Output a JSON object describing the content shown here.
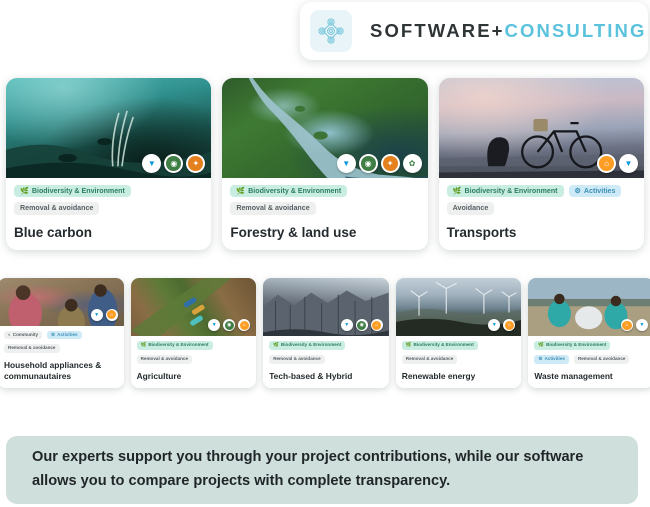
{
  "header": {
    "icon": "network-nodes-icon",
    "title_main": "SOFTWARE",
    "title_plus": "+",
    "title_accent": "CONSULTING"
  },
  "tag_labels": {
    "biodiversity": "Biodiversity & Environment",
    "removal_avoidance": "Removal & avoidance",
    "activities": "Activities",
    "avoidance": "Avoidance",
    "community": "Community"
  },
  "colors": {
    "tag_green_bg": "#c9ede0",
    "tag_green_fg": "#2d7d63",
    "tag_blue_bg": "#cfeaf7",
    "tag_blue_fg": "#3d8fb5",
    "tag_grey_bg": "#eef0f0",
    "tag_grey_fg": "#585f63",
    "accent_blue": "#5bc2dd",
    "banner_bg": "#cfdfdb",
    "title_dark": "#2f3437"
  },
  "big_cards": [
    {
      "title": "Blue carbon",
      "photo": "underwater-seagrass-photo",
      "tags": [
        {
          "label": "Biodiversity & Environment",
          "style": "green",
          "icon": "leaf-icon"
        },
        {
          "label": "Removal & avoidance",
          "style": "grey",
          "icon": ""
        }
      ],
      "sdg": [
        "sdg-14-life-below-water",
        "sdg-13-climate-action",
        "sdg-15-life-on-land"
      ]
    },
    {
      "title": "Forestry & land use",
      "photo": "aerial-forest-river-photo",
      "tags": [
        {
          "label": "Biodiversity & Environment",
          "style": "green",
          "icon": "leaf-icon"
        },
        {
          "label": "Removal & avoidance",
          "style": "grey",
          "icon": ""
        }
      ],
      "sdg": [
        "sdg-14-life-below-water",
        "sdg-13-climate-action",
        "sdg-15-life-on-land",
        "sdg-17-partnerships"
      ]
    },
    {
      "title": "Transports",
      "photo": "bicycle-city-dusk-photo",
      "tags": [
        {
          "label": "Biodiversity & Environment",
          "style": "green",
          "icon": "leaf-icon"
        },
        {
          "label": "Activities",
          "style": "blue",
          "icon": "gear-icon"
        },
        {
          "label": "Avoidance",
          "style": "grey",
          "icon": ""
        }
      ],
      "sdg": [
        "sdg-11-sustainable-cities",
        "sdg-14-life-below-water"
      ]
    }
  ],
  "small_cards": [
    {
      "title": "Household appliances & communautaires",
      "photo": "village-community-photo",
      "tags": [
        {
          "label": "Community",
          "style": "grey",
          "icon": "people-icon"
        },
        {
          "label": "Activities",
          "style": "blue",
          "icon": "gear-icon"
        },
        {
          "label": "Removal & avoidance",
          "style": "grey",
          "icon": ""
        }
      ],
      "sdg": [
        "sdg-14-life-below-water",
        "sdg-11-sustainable-cities"
      ]
    },
    {
      "title": "Agriculture",
      "photo": "aerial-farm-field-photo",
      "tags": [
        {
          "label": "Biodiversity & Environment",
          "style": "green",
          "icon": "leaf-icon"
        },
        {
          "label": "Removal & avoidance",
          "style": "grey",
          "icon": ""
        }
      ],
      "sdg": [
        "sdg-14-life-below-water",
        "sdg-06-clean-water",
        "sdg-11-sustainable-cities"
      ]
    },
    {
      "title": "Tech-based & Hybrid",
      "photo": "rock-cliff-photo",
      "tags": [
        {
          "label": "Biodiversity & Environment",
          "style": "green",
          "icon": "leaf-icon"
        },
        {
          "label": "Removal & avoidance",
          "style": "grey",
          "icon": ""
        }
      ],
      "sdg": [
        "sdg-14-life-below-water",
        "sdg-09-industry",
        "sdg-11-sustainable-cities"
      ]
    },
    {
      "title": "Renewable energy",
      "photo": "wind-turbines-photo",
      "tags": [
        {
          "label": "Biodiversity & Environment",
          "style": "green",
          "icon": "leaf-icon"
        },
        {
          "label": "Removal & avoidance",
          "style": "grey",
          "icon": ""
        }
      ],
      "sdg": [
        "sdg-14-life-below-water",
        "sdg-11-sustainable-cities"
      ]
    },
    {
      "title": "Waste management",
      "photo": "beach-cleanup-photo",
      "tags": [
        {
          "label": "Biodiversity & Environment",
          "style": "green",
          "icon": "leaf-icon"
        },
        {
          "label": "Activities",
          "style": "blue",
          "icon": "gear-icon"
        },
        {
          "label": "Removal & avoidance",
          "style": "grey",
          "icon": ""
        }
      ],
      "sdg": [
        "sdg-11-sustainable-cities",
        "sdg-14-life-below-water"
      ]
    }
  ],
  "banner": {
    "text": "Our experts support you through your project contributions, while our software allows you to compare projects with complete transparency."
  }
}
